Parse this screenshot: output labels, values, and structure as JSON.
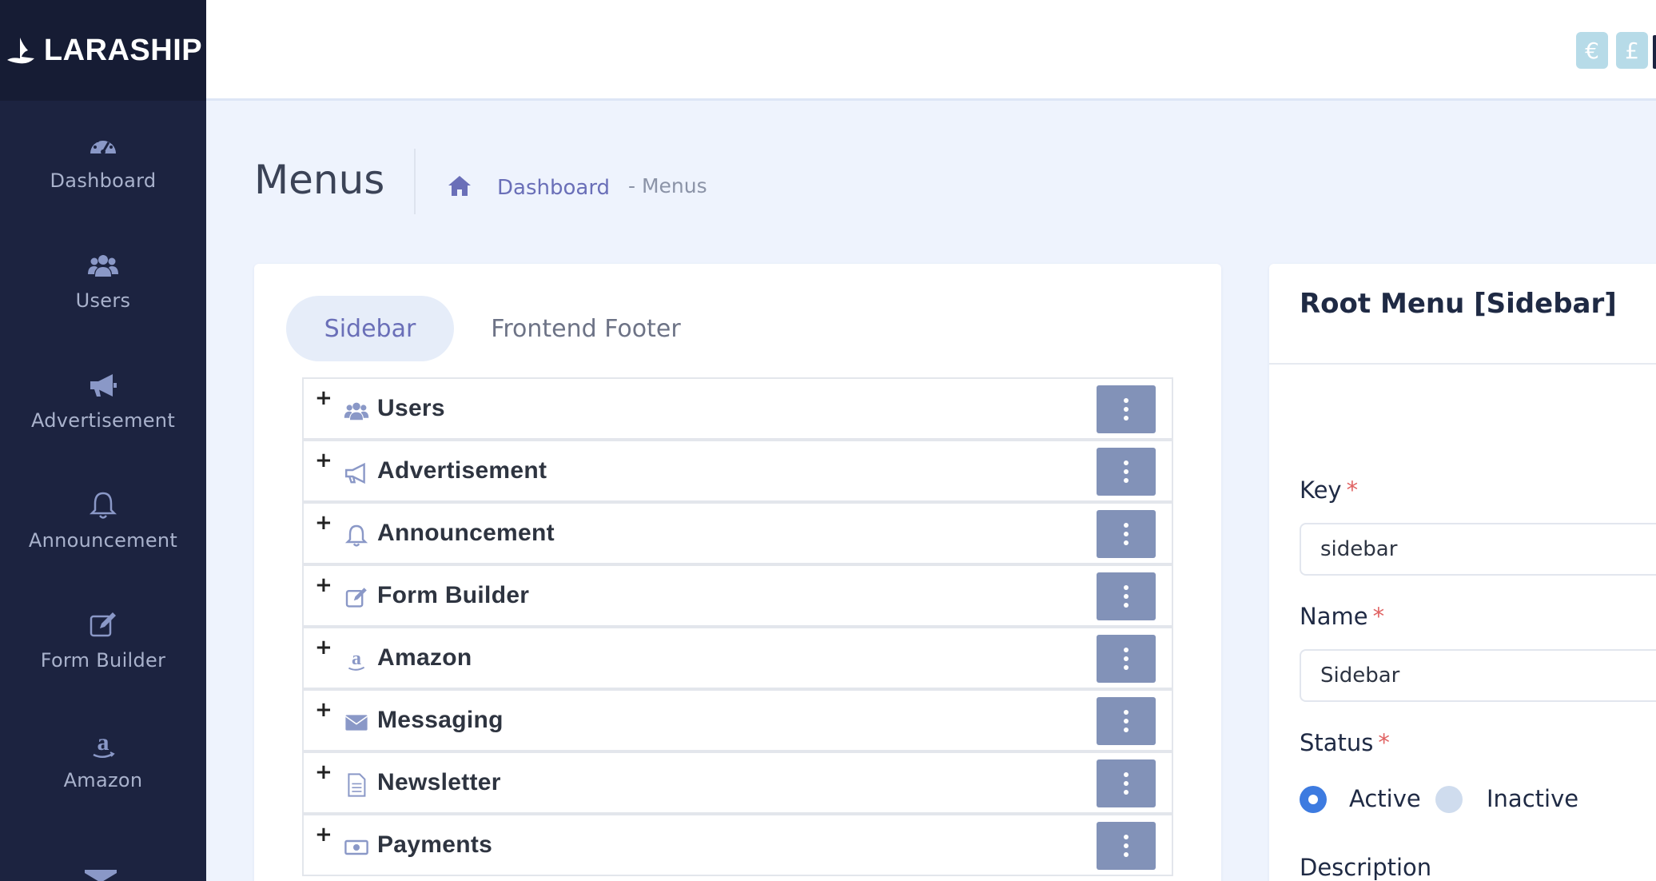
{
  "brand": {
    "name": "LARASHIP"
  },
  "sidebar": {
    "items": [
      {
        "label": "Dashboard",
        "icon": "dashboard-gauge-icon"
      },
      {
        "label": "Users",
        "icon": "users-icon"
      },
      {
        "label": "Advertisement",
        "icon": "megaphone-icon"
      },
      {
        "label": "Announcement",
        "icon": "bell-icon"
      },
      {
        "label": "Form Builder",
        "icon": "edit-icon"
      },
      {
        "label": "Amazon",
        "icon": "amazon-icon"
      }
    ]
  },
  "topbar": {
    "currencies": [
      {
        "symbol": "€",
        "icon": "euro-icon"
      },
      {
        "symbol": "£",
        "icon": "pound-icon"
      }
    ],
    "accent_color": "#b7dbe8"
  },
  "header": {
    "title": "Menus",
    "breadcrumb": {
      "link": "Dashboard",
      "current": "- Menus"
    }
  },
  "tabs": [
    {
      "label": "Sidebar",
      "active": true
    },
    {
      "label": "Frontend Footer",
      "active": false
    }
  ],
  "menu_items": [
    {
      "label": "Users",
      "icon": "users-icon"
    },
    {
      "label": "Advertisement",
      "icon": "megaphone-icon"
    },
    {
      "label": "Announcement",
      "icon": "bell-icon"
    },
    {
      "label": "Form Builder",
      "icon": "edit-icon"
    },
    {
      "label": "Amazon",
      "icon": "amazon-icon"
    },
    {
      "label": "Messaging",
      "icon": "envelope-icon"
    },
    {
      "label": "Newsletter",
      "icon": "document-icon"
    },
    {
      "label": "Payments",
      "icon": "money-icon"
    }
  ],
  "expand_symbol": "+",
  "form": {
    "title": "Root Menu [Sidebar]",
    "key": {
      "label": "Key",
      "required": "*",
      "value": "sidebar"
    },
    "name": {
      "label": "Name",
      "required": "*",
      "value": "Sidebar"
    },
    "status": {
      "label": "Status",
      "required": "*",
      "options": [
        {
          "label": "Active",
          "selected": true
        },
        {
          "label": "Inactive",
          "selected": false
        }
      ]
    },
    "description": {
      "label": "Description"
    }
  },
  "colors": {
    "sidebar_bg": "#1c2340",
    "accent": "#6a6fb8",
    "kebab_button": "#8292b8",
    "radio_active": "#3d7be0",
    "required": "#e06363"
  }
}
